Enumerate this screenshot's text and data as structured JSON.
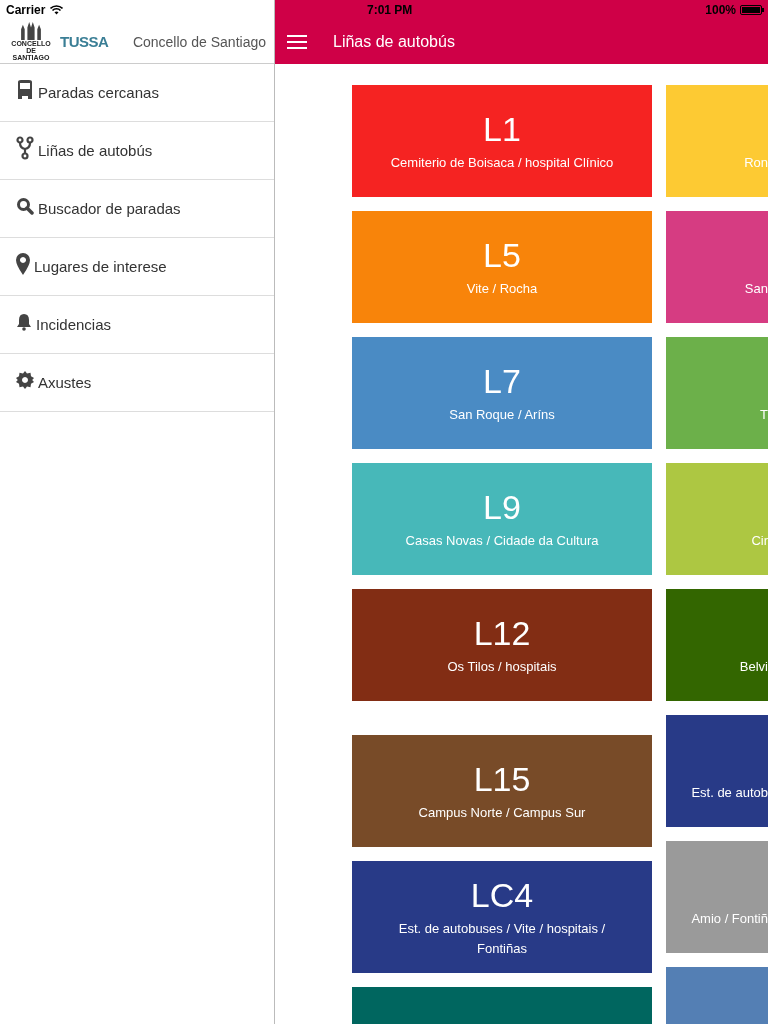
{
  "status_bar": {
    "carrier": "Carrier",
    "time": "7:01 PM",
    "battery": "100%"
  },
  "sidebar": {
    "logo_caption": "CONCELLO DE SANTIAGO",
    "brand": "TUSSA",
    "title": "Concello de Santiago",
    "items": [
      {
        "kind": "bus",
        "label": "Paradas cercanas"
      },
      {
        "kind": "route",
        "label": "Liñas de autobús"
      },
      {
        "kind": "search",
        "label": "Buscador de paradas"
      },
      {
        "kind": "pin",
        "label": "Lugares de interese"
      },
      {
        "kind": "bell",
        "label": "Incidencias"
      },
      {
        "kind": "gear",
        "label": "Axustes"
      }
    ]
  },
  "header": {
    "title": "Liñas de autobús"
  },
  "left_column": [
    {
      "code": "L1",
      "route": "Cemiterio de Boisaca / hospital Clínico",
      "color": "#f52322"
    },
    {
      "code": "L5",
      "route": "Vite / Rocha",
      "color": "#f8840a"
    },
    {
      "code": "L7",
      "route": "San Roque / Aríns",
      "color": "#4a8bc4"
    },
    {
      "code": "L9",
      "route": "Casas Novas / Cidade da Cultura",
      "color": "#47b8b9"
    },
    {
      "code": "L12",
      "route": "Os Tilos / hospitais",
      "color": "#822d14"
    },
    {
      "code": "L15",
      "route": "Campus Norte / Campus Sur",
      "color": "#784b28"
    },
    {
      "code": "LC4",
      "route": "Est. de autobuses / Vite / hospitais / Fontiñas",
      "color": "#283a87"
    },
    {
      "color": "#00665f"
    }
  ],
  "right_column": [
    {
      "route": "Ron",
      "color": "#fdca33"
    },
    {
      "route": "San",
      "color": "#d63c82"
    },
    {
      "route": "T",
      "color": "#6cb04a"
    },
    {
      "route": "Cir",
      "color": "#adc742"
    },
    {
      "route": "Belvi",
      "color": "#336600"
    },
    {
      "route": "Est. de autob",
      "color": "#283a87"
    },
    {
      "route": "Amio / Fontiñ",
      "color": "#9a9a9a"
    },
    {
      "color": "#547fb4"
    }
  ]
}
